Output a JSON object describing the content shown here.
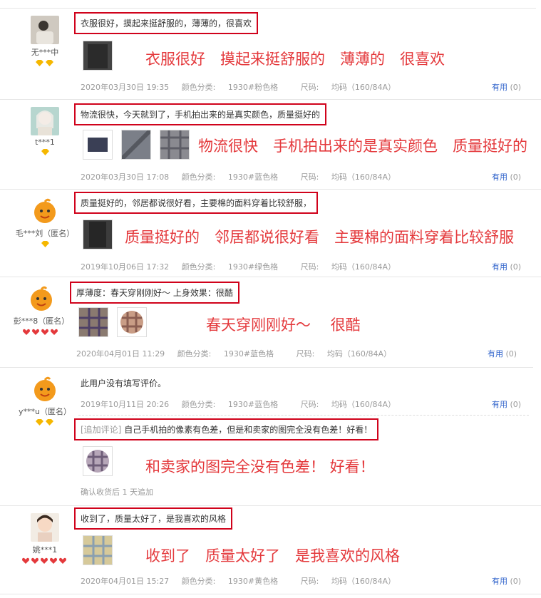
{
  "colors": {
    "highlight": "#d0021b",
    "big_text": "#e4393c",
    "useful": "#3366cc",
    "meta": "#9a9a9a"
  },
  "labels": {
    "color_prefix": "颜色分类:",
    "size_prefix": "尺码:",
    "useful": "有用",
    "useful_count": "(0)"
  },
  "reviews": [
    {
      "user": "无***中",
      "avatar": "avatar-photo",
      "level": "2 diamonds",
      "text": "衣服很好，摸起来挺舒服的，薄薄的，很喜欢",
      "big": "衣服很好　摸起来挺舒服的　薄薄的　很喜欢",
      "date": "2020年03月30日 19:35",
      "color": "1930#粉色格",
      "size": "均码（160/84A）"
    },
    {
      "user": "t***1",
      "avatar": "avatar-photo",
      "level": "1 diamond",
      "text": "物流很快，今天就到了，手机拍出来的是真实颜色，质量挺好的",
      "big": "物流很快　手机拍出来的是真实颜色　质量挺好的",
      "date": "2020年03月30日 17:08",
      "color": "1930#蓝色格",
      "size": "均码（160/84A）"
    },
    {
      "user": "毛***刘（匿名）",
      "avatar": "anonymous-mascot",
      "level": "1 diamond",
      "text": "质量挺好的，邻居都说很好看，主要棉的面料穿着比较舒服，",
      "big": "质量挺好的　邻居都说很好看　主要棉的面料穿着比较舒服",
      "date": "2019年10月06日 17:32",
      "color": "1930#绿色格",
      "size": "均码（160/84A）"
    },
    {
      "user": "彭***8（匿名）",
      "avatar": "anonymous-mascot",
      "level": "4 red hearts",
      "text": "厚薄度：春天穿刚刚好～ 上身效果：很酷",
      "big": "春天穿刚刚好～　 很酷",
      "date": "2020年04月01日 11:29",
      "color": "1930#蓝色格",
      "size": "均码（160/84A）"
    },
    {
      "user": "y***u（匿名）",
      "avatar": "anonymous-mascot",
      "level": "2 diamonds",
      "text": "此用户没有填写评价。",
      "date": "2019年10月11日 20:26",
      "color": "1930#蓝色格",
      "size": "均码（160/84A）",
      "append_tag": "[追加评论]",
      "append_text": "自己手机拍的像素有色差，但是和卖家的图完全没有色差！好看！",
      "big": "和卖家的图完全没有色差！ 好看！",
      "append_note": "确认收货后 1 天追加"
    },
    {
      "user": "姚***1",
      "avatar": "avatar-photo",
      "level": "5 red hearts",
      "text": "收到了，质量太好了，是我喜欢的风格",
      "big": "收到了　质量太好了　是我喜欢的风格",
      "date": "2020年04月01日 15:27",
      "color": "1930#黄色格",
      "size": "均码（160/84A）"
    }
  ]
}
